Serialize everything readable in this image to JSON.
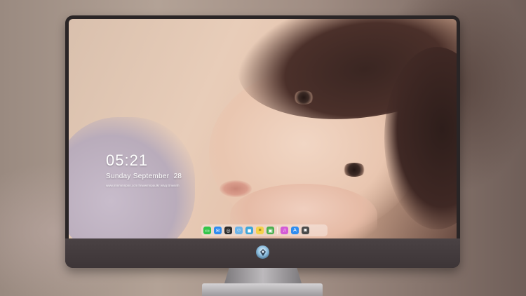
{
  "lock_screen": {
    "time": "05:21",
    "date": "Sunday September  28",
    "subtitle": "www.mmmmnpnn.ccm   hnwwmnpaulkr wtvg  Bnwnnh"
  },
  "dock": {
    "apps": [
      {
        "name": "messages",
        "color": "#33c54a",
        "glyph": "▭"
      },
      {
        "name": "mail",
        "color": "#2f8cf0",
        "glyph": "✉"
      },
      {
        "name": "safari",
        "color": "#2d2d2d",
        "glyph": "◎"
      },
      {
        "name": "finder",
        "color": "#6db4e8",
        "glyph": "☺"
      },
      {
        "name": "claquette",
        "color": "#3fa6d8",
        "glyph": "◼"
      },
      {
        "name": "notes",
        "color": "#f5d24a",
        "glyph": "≡"
      },
      {
        "name": "photos-viewer",
        "color": "#4caf50",
        "glyph": "▣"
      },
      {
        "name": "itunes",
        "color": "#d45bd6",
        "glyph": "♫"
      },
      {
        "name": "app-store",
        "color": "#2f8cf0",
        "glyph": "A"
      },
      {
        "name": "camera",
        "color": "#4a4a4a",
        "glyph": "◙"
      }
    ]
  }
}
